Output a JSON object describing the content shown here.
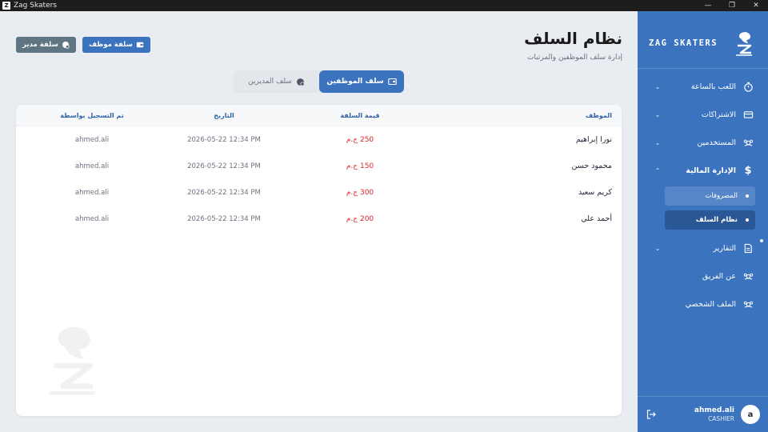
{
  "window": {
    "title": "Zag Skaters"
  },
  "sidebar": {
    "brand": "ZAG SKATERS",
    "items": [
      {
        "label": "اللعب بالساعة",
        "icon": "stopwatch-icon"
      },
      {
        "label": "الاشتراكات",
        "icon": "card-icon"
      },
      {
        "label": "المستخدمين",
        "icon": "users-icon"
      },
      {
        "label": "الإدارة المالية",
        "icon": "dollar-icon"
      },
      {
        "label": "التقارير",
        "icon": "document-icon"
      },
      {
        "label": "عن الفريق",
        "icon": "team-icon"
      },
      {
        "label": "الملف الشخصي",
        "icon": "profile-icon"
      }
    ],
    "sub_items": [
      {
        "label": "المصروفات"
      },
      {
        "label": "نظام السلف"
      }
    ],
    "user": {
      "name": "ahmed.ali",
      "role": "CASHIER",
      "avatar": "a"
    }
  },
  "header": {
    "title": "نظام السلف",
    "subtitle": "إدارة سلف الموظفين والمرتبات"
  },
  "actions": {
    "employee_advance": "سلفة موظف",
    "manager_advance": "سلفة مدير"
  },
  "tabs": {
    "employees": "سلف الموظفين",
    "managers": "سلف المديرين"
  },
  "table": {
    "headers": {
      "employee": "الموظف",
      "amount": "قيمة السلفة",
      "date": "التاريخ",
      "recorded_by": "تم التسجيل بواسطة"
    },
    "rows": [
      {
        "employee": "نورا إبراهيم",
        "amount": "250 ج.م",
        "date": "2026-05-22 12:34 PM",
        "recorded_by": "ahmed.ali"
      },
      {
        "employee": "محمود حسن",
        "amount": "150 ج.م",
        "date": "2026-05-22 12:34 PM",
        "recorded_by": "ahmed.ali"
      },
      {
        "employee": "كريم سعيد",
        "amount": "300 ج.م",
        "date": "2026-05-22 12:34 PM",
        "recorded_by": "ahmed.ali"
      },
      {
        "employee": "أحمد علي",
        "amount": "200 ج.م",
        "date": "2026-05-22 12:34 PM",
        "recorded_by": "ahmed.ali"
      }
    ]
  },
  "colors": {
    "primary": "#3b73bf",
    "primary_dark": "#2a5796",
    "secondary": "#5f7581",
    "amount": "#dc2626"
  }
}
